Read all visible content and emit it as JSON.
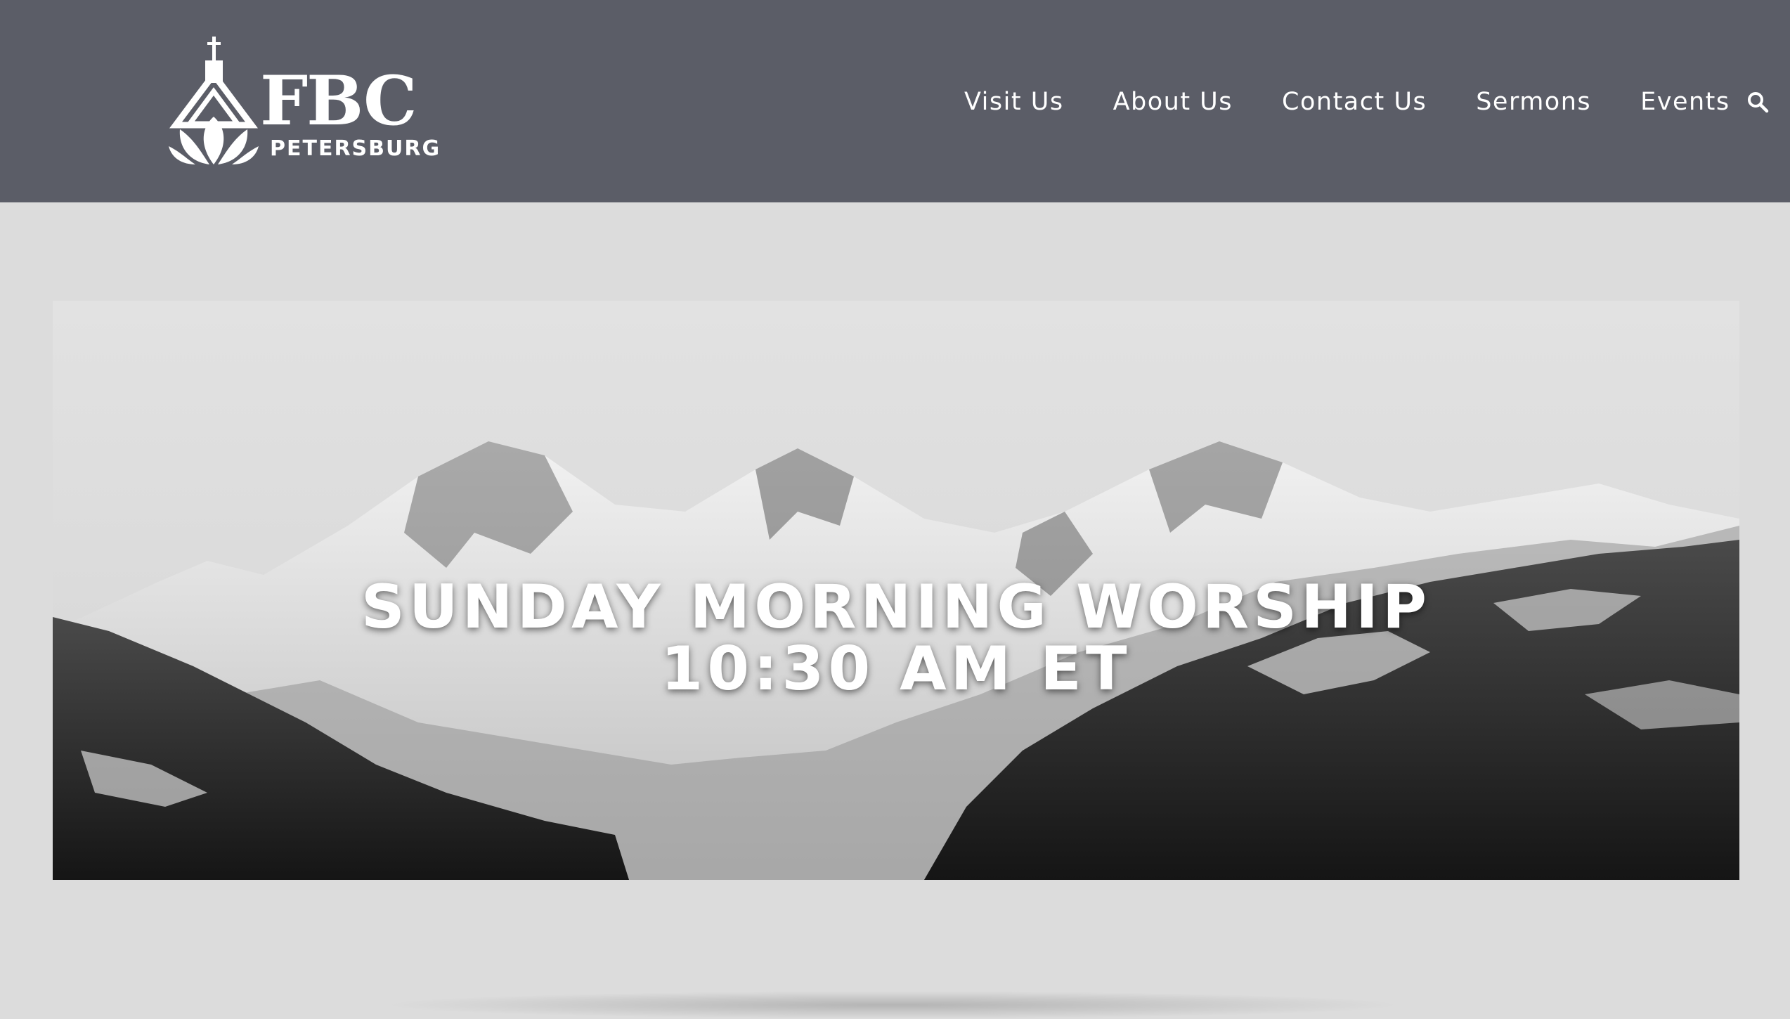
{
  "header": {
    "logo": {
      "wordmark": "FBC",
      "subtitle": "PETERSBURG"
    },
    "nav": [
      {
        "label": "Visit Us"
      },
      {
        "label": "About Us"
      },
      {
        "label": "Contact Us"
      },
      {
        "label": "Sermons"
      },
      {
        "label": "Events"
      }
    ],
    "search_icon": "search-icon",
    "background_color": "#5b5d67"
  },
  "hero": {
    "title_line1": "SUNDAY MORNING WORSHIP",
    "title_line2": "10:30 AM ET",
    "image": "mountain-range-image"
  },
  "page_background": "#dcdcdc"
}
